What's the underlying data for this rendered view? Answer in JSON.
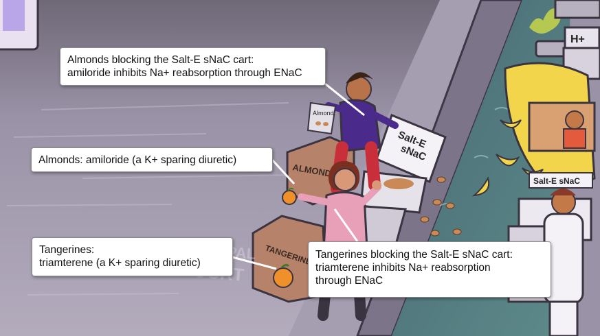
{
  "callouts": [
    {
      "id": "almonds-cart",
      "lines": [
        "Almonds blocking the Salt-E sNaC cart:",
        "amiloride inhibits Na+ reabsorption through ENaC"
      ]
    },
    {
      "id": "almonds",
      "lines": [
        "Almonds: amiloride (a K+ sparing diuretic)"
      ]
    },
    {
      "id": "tangerines",
      "lines": [
        "Tangerines:",
        "triamterene (a K+ sparing diuretic)"
      ]
    },
    {
      "id": "tangerines-cart",
      "lines": [
        "Tangerines blocking the Salt-E sNaC cart:",
        "triamterene inhibits Na+ reabsorption",
        "through ENaC"
      ]
    }
  ],
  "scene_text": {
    "cart_sign_top": "Salt-E",
    "cart_sign_bottom": "sNaC",
    "almonds_box": "ALMONDS",
    "almond_bag": "Almond",
    "tangerines_box": "TANGERINES",
    "back_cart_sign": "Salt-E sNaC",
    "pump_sign": "H+",
    "floor_text_top": "PRINCIPAL",
    "floor_text_bottom": "COURT"
  },
  "colors": {
    "wall": "#8d8599",
    "canal_water": "#4f6f78",
    "callout_bg": "#ffffff",
    "box_brown": "#b7826a",
    "tangerine": "#f0902a",
    "banana": "#f2d54a",
    "man_shirt": "#4a2a8a",
    "woman_shirt": "#e8a0b8"
  }
}
